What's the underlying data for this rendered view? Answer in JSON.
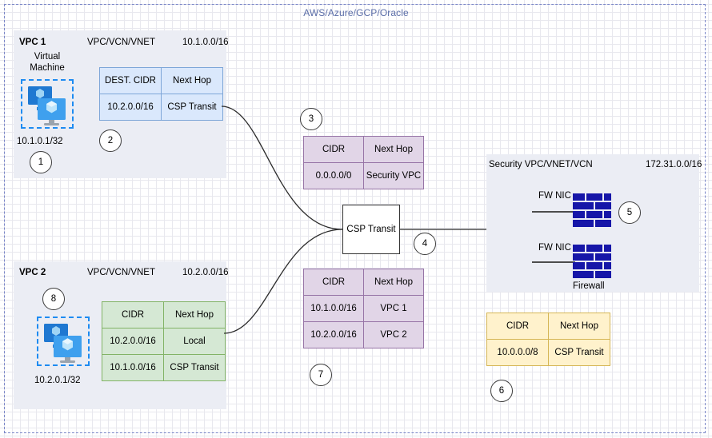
{
  "diagram": {
    "title": "AWS/Azure/GCP/Oracle"
  },
  "vpc1": {
    "name": "VPC 1",
    "type": "VPC/VCN/VNET",
    "cidr": "10.1.0.0/16",
    "vm_label_line1": "Virtual",
    "vm_label_line2": "Machine",
    "vm_ip": "10.1.0.1/32",
    "vm_icon": "virtual-machine-icon",
    "step_vm": "1",
    "step_table": "2",
    "route_table": {
      "headers": [
        "DEST. CIDR",
        "Next Hop"
      ],
      "rows": [
        [
          "10.2.0.0/16",
          "CSP Transit"
        ]
      ],
      "color": "#dae8fc"
    }
  },
  "vpc2": {
    "name": "VPC 2",
    "type": "VPC/VCN/VNET",
    "cidr": "10.2.0.0/16",
    "vm_ip": "10.2.0.1/32",
    "vm_icon": "virtual-machine-icon",
    "step_vm": "8",
    "route_table": {
      "headers": [
        "CIDR",
        "Next Hop"
      ],
      "rows": [
        [
          "10.2.0.0/16",
          "Local"
        ],
        [
          "10.1.0.0/16",
          "CSP Transit"
        ]
      ],
      "color": "#d5e8d4"
    }
  },
  "transit": {
    "node_label": "CSP Transit",
    "step_upper_table": "3",
    "step_node": "4",
    "step_lower_table": "7",
    "upper_table": {
      "headers": [
        "CIDR",
        "Next Hop"
      ],
      "rows": [
        [
          "0.0.0.0/0",
          "Security VPC"
        ]
      ],
      "color": "#e1d5e7"
    },
    "lower_table": {
      "headers": [
        "CIDR",
        "Next Hop"
      ],
      "rows": [
        [
          "10.1.0.0/16",
          "VPC 1"
        ],
        [
          "10.2.0.0/16",
          "VPC 2"
        ]
      ],
      "color": "#e1d5e7"
    }
  },
  "security_vpc": {
    "name": "Security VPC/VNET/VCN",
    "cidr": "172.31.0.0/16",
    "nic_top_label": "FW NIC",
    "nic_bottom_label": "FW NIC",
    "firewall_label": "Firewall",
    "firewall_icon": "firewall-brick-icon",
    "firewall_color": "#1616a8",
    "step_firewall": "5",
    "route_table": {
      "headers": [
        "CIDR",
        "Next Hop"
      ],
      "rows": [
        [
          "10.0.0.0/8",
          "CSP Transit"
        ]
      ],
      "color": "#fff2cc"
    },
    "step_table": "6"
  }
}
